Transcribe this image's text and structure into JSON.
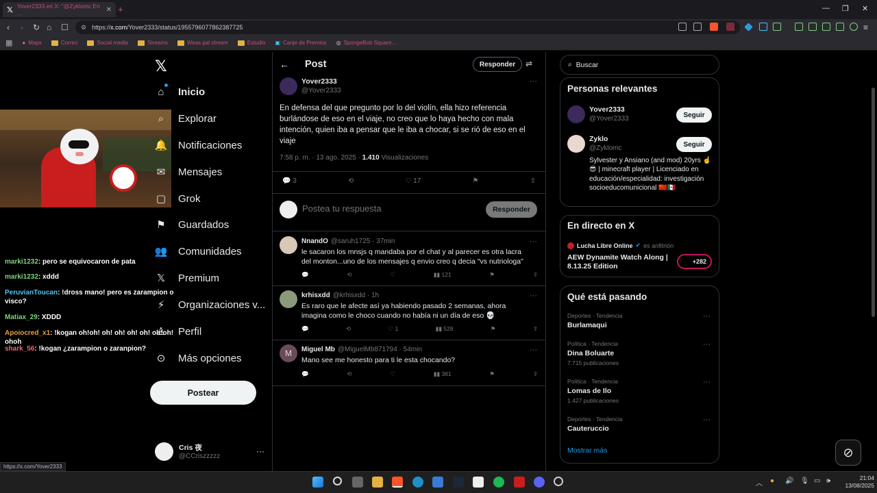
{
  "browser": {
    "tab_title": "Yover2333 en X: \"@Zyklomc En ...",
    "url_prefix": "https://",
    "url_host": "x.com",
    "url_path": "/Yover2333/status/1955796077862387725",
    "bookmarks": [
      {
        "label": "Maps",
        "icon": "map-pin-icon"
      },
      {
        "label": "Correo",
        "icon": "folder-icon"
      },
      {
        "label": "Social media",
        "icon": "folder-icon"
      },
      {
        "label": "Streams",
        "icon": "folder-icon"
      },
      {
        "label": "Weas pal stream",
        "icon": "folder-icon"
      },
      {
        "label": "Estudio",
        "icon": "folder-icon"
      },
      {
        "label": "Canje de Premios",
        "icon": "gift-icon"
      },
      {
        "label": "SpongeBob Square...",
        "icon": "globe-icon"
      }
    ],
    "status_url": "https://x.com/Yover2333"
  },
  "stream_chat": [
    {
      "user": "marki1232",
      "color": "#7fd37f",
      "text": "pero se equivocaron de pata"
    },
    {
      "user": "marki1232",
      "color": "#7fd37f",
      "text": "xddd"
    },
    {
      "user": "PeruvianToucan",
      "color": "#4fc3f7",
      "text": "!dross mano! pero es zarampion o visco?"
    },
    {
      "user": "Matiax_29",
      "color": "#7fd37f",
      "text": "XDDD"
    },
    {
      "user": "Apoiocred_x1",
      "color": "#e8a23a",
      "text": "!kogan oh!oh! oh! oh! oh! oh! oh!oh! ohoh"
    },
    {
      "user": "shark_56",
      "color": "#e06c75",
      "text": "!kogan ¿zarampion o zaranpion?"
    }
  ],
  "nav": {
    "items": [
      {
        "label": "Inicio",
        "icon": "home-icon"
      },
      {
        "label": "Explorar",
        "icon": "search-icon"
      },
      {
        "label": "Notificaciones",
        "icon": "bell-icon"
      },
      {
        "label": "Mensajes",
        "icon": "mail-icon"
      },
      {
        "label": "Grok",
        "icon": "grok-icon"
      },
      {
        "label": "Guardados",
        "icon": "bookmark-icon"
      },
      {
        "label": "Comunidades",
        "icon": "people-icon"
      },
      {
        "label": "Premium",
        "icon": "x-icon"
      },
      {
        "label": "Organizaciones v...",
        "icon": "lightning-icon"
      },
      {
        "label": "Perfil",
        "icon": "person-icon"
      },
      {
        "label": "Más opciones",
        "icon": "more-circle-icon"
      }
    ],
    "post_button": "Postear",
    "account_name": "Cris 夜",
    "account_handle": "@CCriszzzzz"
  },
  "post": {
    "header_title": "Post",
    "reply_pill": "Responder",
    "author_name": "Yover2333",
    "author_handle": "@Yover2333",
    "text": "En defensa del que pregunto por lo del violín, ella hizo referencia burlándose de eso en el viaje, no creo que lo haya hecho con mala intención, quien iba a pensar que le iba a chocar, si se rió de eso en el viaje",
    "time": "7:58 p. m. · 13 ago. 2025 · ",
    "views_count": "1.410",
    "views_label": " Visualizaciones",
    "replies": "3",
    "likes": "17",
    "composer_placeholder": "Postea tu respuesta",
    "composer_button": "Responder"
  },
  "replies": [
    {
      "name": "NnandO",
      "handle": "@saruh1725 · 37min",
      "text": "le sacaron los mnsjs q mandaba por el chat y al parecer es otra lacra del monton...uno de los mensajes q envio creo q decia \"vs nutriologa\"",
      "reply_count": "",
      "like_count": "",
      "views": "121"
    },
    {
      "name": "krhisxdd",
      "handle": "@krhisxdd · 1h",
      "text": "Es raro que le afecte así ya habiendo pasado 2 semanas, ahora imagina como le choco cuando no había ni un día de eso 💀",
      "reply_count": "",
      "like_count": "1",
      "views": "528"
    },
    {
      "name": "Miguel Mb",
      "handle": "@MiguelMb871794 · 54min",
      "text": "Mano see me honesto para ti le esta chocando?",
      "reply_count": "",
      "like_count": "",
      "views": "381",
      "avatar_letter": "M"
    }
  ],
  "right": {
    "search_placeholder": "Buscar",
    "relevant_title": "Personas relevantes",
    "people": [
      {
        "name": "Yover2333",
        "handle": "@Yover2333",
        "button": "Seguir"
      },
      {
        "name": "Zyklo",
        "handle": "@Zyklomc",
        "button": "Seguir",
        "bio": "Sylvester y Ansiano (and mod) 20yrs ☝️😎 | minecraft player | Licenciado en educación/especialidad: investigación socioeducomunicional 🇨🇳🇲🇽"
      }
    ],
    "live_title": "En directo en X",
    "live_host": "Lucha Libre Online",
    "live_host_suffix": "es anfitrión",
    "live_event": "AEW Dynamite Watch Along | 8.13.25 Edition",
    "live_count": "+282",
    "trending_title": "Qué está pasando",
    "trends": [
      {
        "category": "Deportes · Tendencia",
        "name": "Burlamaqui",
        "count": ""
      },
      {
        "category": "Política · Tendencia",
        "name": "Dina Boluarte",
        "count": "7.715 publicaciones"
      },
      {
        "category": "Política · Tendencia",
        "name": "Lomas de Ilo",
        "count": "1.427 publicaciones"
      },
      {
        "category": "Deportes · Tendencia",
        "name": "Cauteruccio",
        "count": ""
      }
    ],
    "show_more": "Mostrar más"
  },
  "taskbar": {
    "time": "21:04",
    "date": "13/08/2025"
  },
  "colors": {
    "accent": "#1d9bf0",
    "brave_orange": "#fb542b",
    "tab_text": "#c94b7b"
  }
}
